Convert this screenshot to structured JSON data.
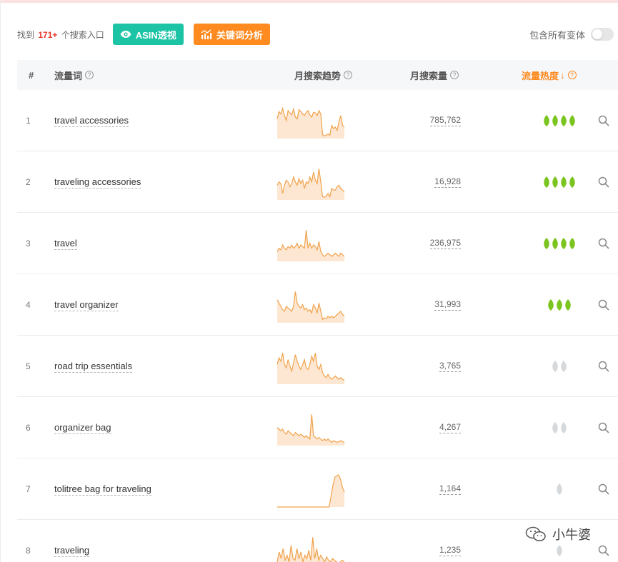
{
  "toolbar": {
    "found_prefix": "找到",
    "found_count": "171+",
    "found_suffix": "个搜索入口",
    "asin_button": "ASIN透视",
    "keyword_button": "关键词分析",
    "variant_label": "包含所有变体",
    "variant_toggle_on": false
  },
  "table": {
    "headers": {
      "index": "#",
      "keyword": "流量词",
      "trend": "月搜索趋势",
      "volume": "月搜索量",
      "heat": "流量热度",
      "heat_sort_arrow": "↓"
    },
    "rows": [
      {
        "index": "1",
        "keyword": "travel accessories",
        "volume": "785,762",
        "heat_level": 4,
        "heat_active": true,
        "trend": [
          0.6,
          0.82,
          0.75,
          0.92,
          0.7,
          0.55,
          0.85,
          0.78,
          0.72,
          0.9,
          0.65,
          0.6,
          0.88,
          0.82,
          0.75,
          0.7,
          0.8,
          0.85,
          0.72,
          0.65,
          0.8,
          0.78,
          0.7,
          0.85,
          0.75,
          0.12,
          0.08,
          0.1,
          0.14,
          0.1,
          0.4,
          0.3,
          0.35,
          0.25,
          0.5,
          0.7,
          0.4,
          0.35
        ]
      },
      {
        "index": "2",
        "keyword": "traveling accessories",
        "volume": "16,928",
        "heat_level": 4,
        "heat_active": true,
        "trend": [
          0.45,
          0.55,
          0.5,
          0.2,
          0.45,
          0.6,
          0.55,
          0.4,
          0.5,
          0.7,
          0.55,
          0.45,
          0.65,
          0.5,
          0.6,
          0.35,
          0.55,
          0.5,
          0.7,
          0.55,
          0.85,
          0.6,
          0.5,
          0.95,
          0.55,
          0.1,
          0.08,
          0.12,
          0.2,
          0.1,
          0.35,
          0.3,
          0.3,
          0.4,
          0.45,
          0.35,
          0.3,
          0.25
        ]
      },
      {
        "index": "3",
        "keyword": "travel",
        "volume": "236,975",
        "heat_level": 4,
        "heat_active": true,
        "trend": [
          0.3,
          0.4,
          0.35,
          0.5,
          0.4,
          0.35,
          0.45,
          0.4,
          0.5,
          0.4,
          0.45,
          0.55,
          0.4,
          0.5,
          0.45,
          0.4,
          0.95,
          0.4,
          0.55,
          0.4,
          0.5,
          0.45,
          0.35,
          0.6,
          0.3,
          0.2,
          0.15,
          0.2,
          0.25,
          0.2,
          0.15,
          0.2,
          0.25,
          0.2,
          0.15,
          0.25,
          0.2,
          0.15
        ]
      },
      {
        "index": "4",
        "keyword": "travel organizer",
        "volume": "31,993",
        "heat_level": 3,
        "heat_active": true,
        "trend": [
          0.7,
          0.6,
          0.5,
          0.4,
          0.35,
          0.5,
          0.45,
          0.4,
          0.35,
          0.5,
          0.95,
          0.6,
          0.5,
          0.45,
          0.55,
          0.4,
          0.45,
          0.35,
          0.4,
          0.3,
          0.55,
          0.45,
          0.3,
          0.6,
          0.35,
          0.1,
          0.15,
          0.12,
          0.2,
          0.15,
          0.2,
          0.15,
          0.2,
          0.25,
          0.3,
          0.35,
          0.25,
          0.2
        ]
      },
      {
        "index": "5",
        "keyword": "road trip essentials",
        "volume": "3,765",
        "heat_level": 2,
        "heat_active": false,
        "trend": [
          0.6,
          0.8,
          0.7,
          0.95,
          0.6,
          0.5,
          0.75,
          0.55,
          0.4,
          0.65,
          0.9,
          0.7,
          0.55,
          0.45,
          0.6,
          0.75,
          0.5,
          0.45,
          0.6,
          0.85,
          0.7,
          0.95,
          0.55,
          0.45,
          0.6,
          0.35,
          0.25,
          0.2,
          0.3,
          0.2,
          0.15,
          0.2,
          0.25,
          0.2,
          0.15,
          0.2,
          0.15,
          0.12
        ]
      },
      {
        "index": "6",
        "keyword": "organizer bag",
        "volume": "4,267",
        "heat_level": 2,
        "heat_active": false,
        "trend": [
          0.55,
          0.5,
          0.45,
          0.5,
          0.4,
          0.35,
          0.45,
          0.4,
          0.35,
          0.3,
          0.4,
          0.35,
          0.3,
          0.35,
          0.3,
          0.25,
          0.3,
          0.25,
          0.2,
          0.95,
          0.3,
          0.25,
          0.2,
          0.25,
          0.2,
          0.15,
          0.2,
          0.15,
          0.2,
          0.15,
          0.1,
          0.15,
          0.12,
          0.1,
          0.12,
          0.15,
          0.12,
          0.1
        ]
      },
      {
        "index": "7",
        "keyword": "tolitree bag for traveling",
        "volume": "1,164",
        "heat_level": 1,
        "heat_active": false,
        "trend": [
          0,
          0,
          0,
          0,
          0,
          0,
          0,
          0,
          0,
          0,
          0,
          0,
          0,
          0,
          0,
          0,
          0,
          0,
          0,
          0,
          0,
          0,
          0,
          0,
          0,
          0,
          0,
          0,
          0.3,
          0.65,
          0.9,
          0.95,
          0.98,
          0.85,
          0.6,
          0.45
        ]
      },
      {
        "index": "8",
        "keyword": "traveling",
        "volume": "1,235",
        "heat_level": 1,
        "heat_active": false,
        "trend": [
          0.2,
          0.5,
          0.3,
          0.6,
          0.25,
          0.4,
          0.2,
          0.7,
          0.3,
          0.25,
          0.6,
          0.3,
          0.5,
          0.2,
          0.4,
          0.3,
          0.55,
          0.25,
          0.95,
          0.3,
          0.6,
          0.25,
          0.4,
          0.3,
          0.2,
          0.35,
          0.25,
          0.2,
          0.3,
          0.25,
          0.2,
          0.15,
          0.2,
          0.25,
          0.2
        ]
      }
    ]
  },
  "colors": {
    "accent_green": "#1cc4a5",
    "accent_orange": "#ff8a1f",
    "count_red": "#e8382b",
    "leaf_active": "#7cc520",
    "leaf_inactive": "#d6d9dc",
    "spark_line": "#f0a24a",
    "spark_fill": "#fde7d3"
  },
  "watermark": {
    "text": "小牛婆",
    "icon": "wechat-icon"
  }
}
